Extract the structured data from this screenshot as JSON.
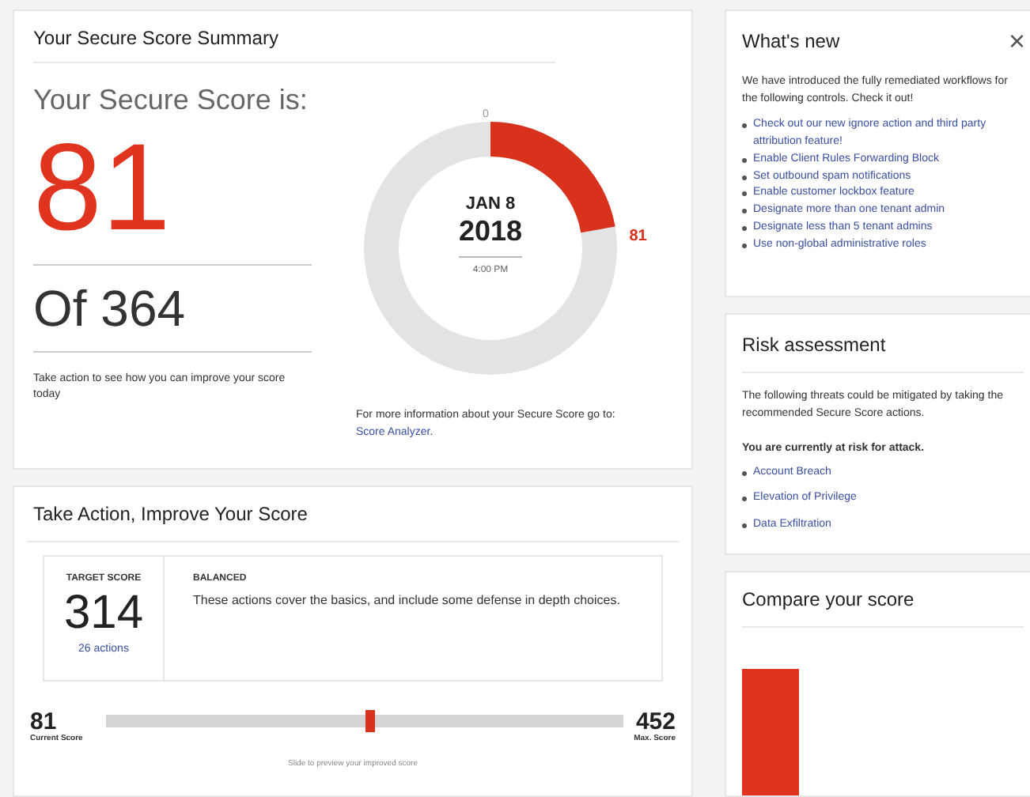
{
  "summary": {
    "title": "Your Secure Score Summary",
    "heading": "Your Secure Score is:",
    "score": "81",
    "of_total": "Of 364",
    "hint": "Take action to see how you can improve your score today",
    "gauge": {
      "level": 0.2225,
      "start_label": "0",
      "value_label": "81",
      "date": "JAN 8",
      "year": "2018",
      "time": "4:00 PM"
    },
    "info_text": "For more information about your Secure Score go to:",
    "info_link": "Score Analyzer",
    "info_end": "."
  },
  "take_action": {
    "title": "Take Action, Improve Your Score",
    "target_label": "TARGET SCORE",
    "target_score": "314",
    "actions_link": "26 actions",
    "plan_title": "BALANCED",
    "plan_text": "These actions cover the basics, and include some defense in depth choices.",
    "slider": {
      "level": 0.51,
      "current": "81",
      "current_label": "Current Score",
      "max": "452",
      "max_label": "Max. Score",
      "hint": "Slide to preview your improved score"
    }
  },
  "whats_new": {
    "title": "What's new",
    "close": "×",
    "intro": "We have introduced the fully remediated workflows for the following controls. Check it out!",
    "links": [
      "Check out our new ignore action and third party attribution feature!",
      "Enable Client Rules Forwarding Block",
      "Set outbound spam notifications",
      "Enable customer lockbox feature",
      "Designate more than one tenant admin",
      "Designate less than 5 tenant admins",
      "Use non-global administrative roles"
    ]
  },
  "risk": {
    "title": "Risk assessment",
    "intro": "The following threats could be mitigated by taking the recommended Secure Score actions.",
    "warning": "You are currently at risk for attack.",
    "threats": [
      "Account Breach",
      "Elevation of Privilege",
      "Data Exfiltration"
    ]
  },
  "compare": {
    "title": "Compare your score"
  }
}
